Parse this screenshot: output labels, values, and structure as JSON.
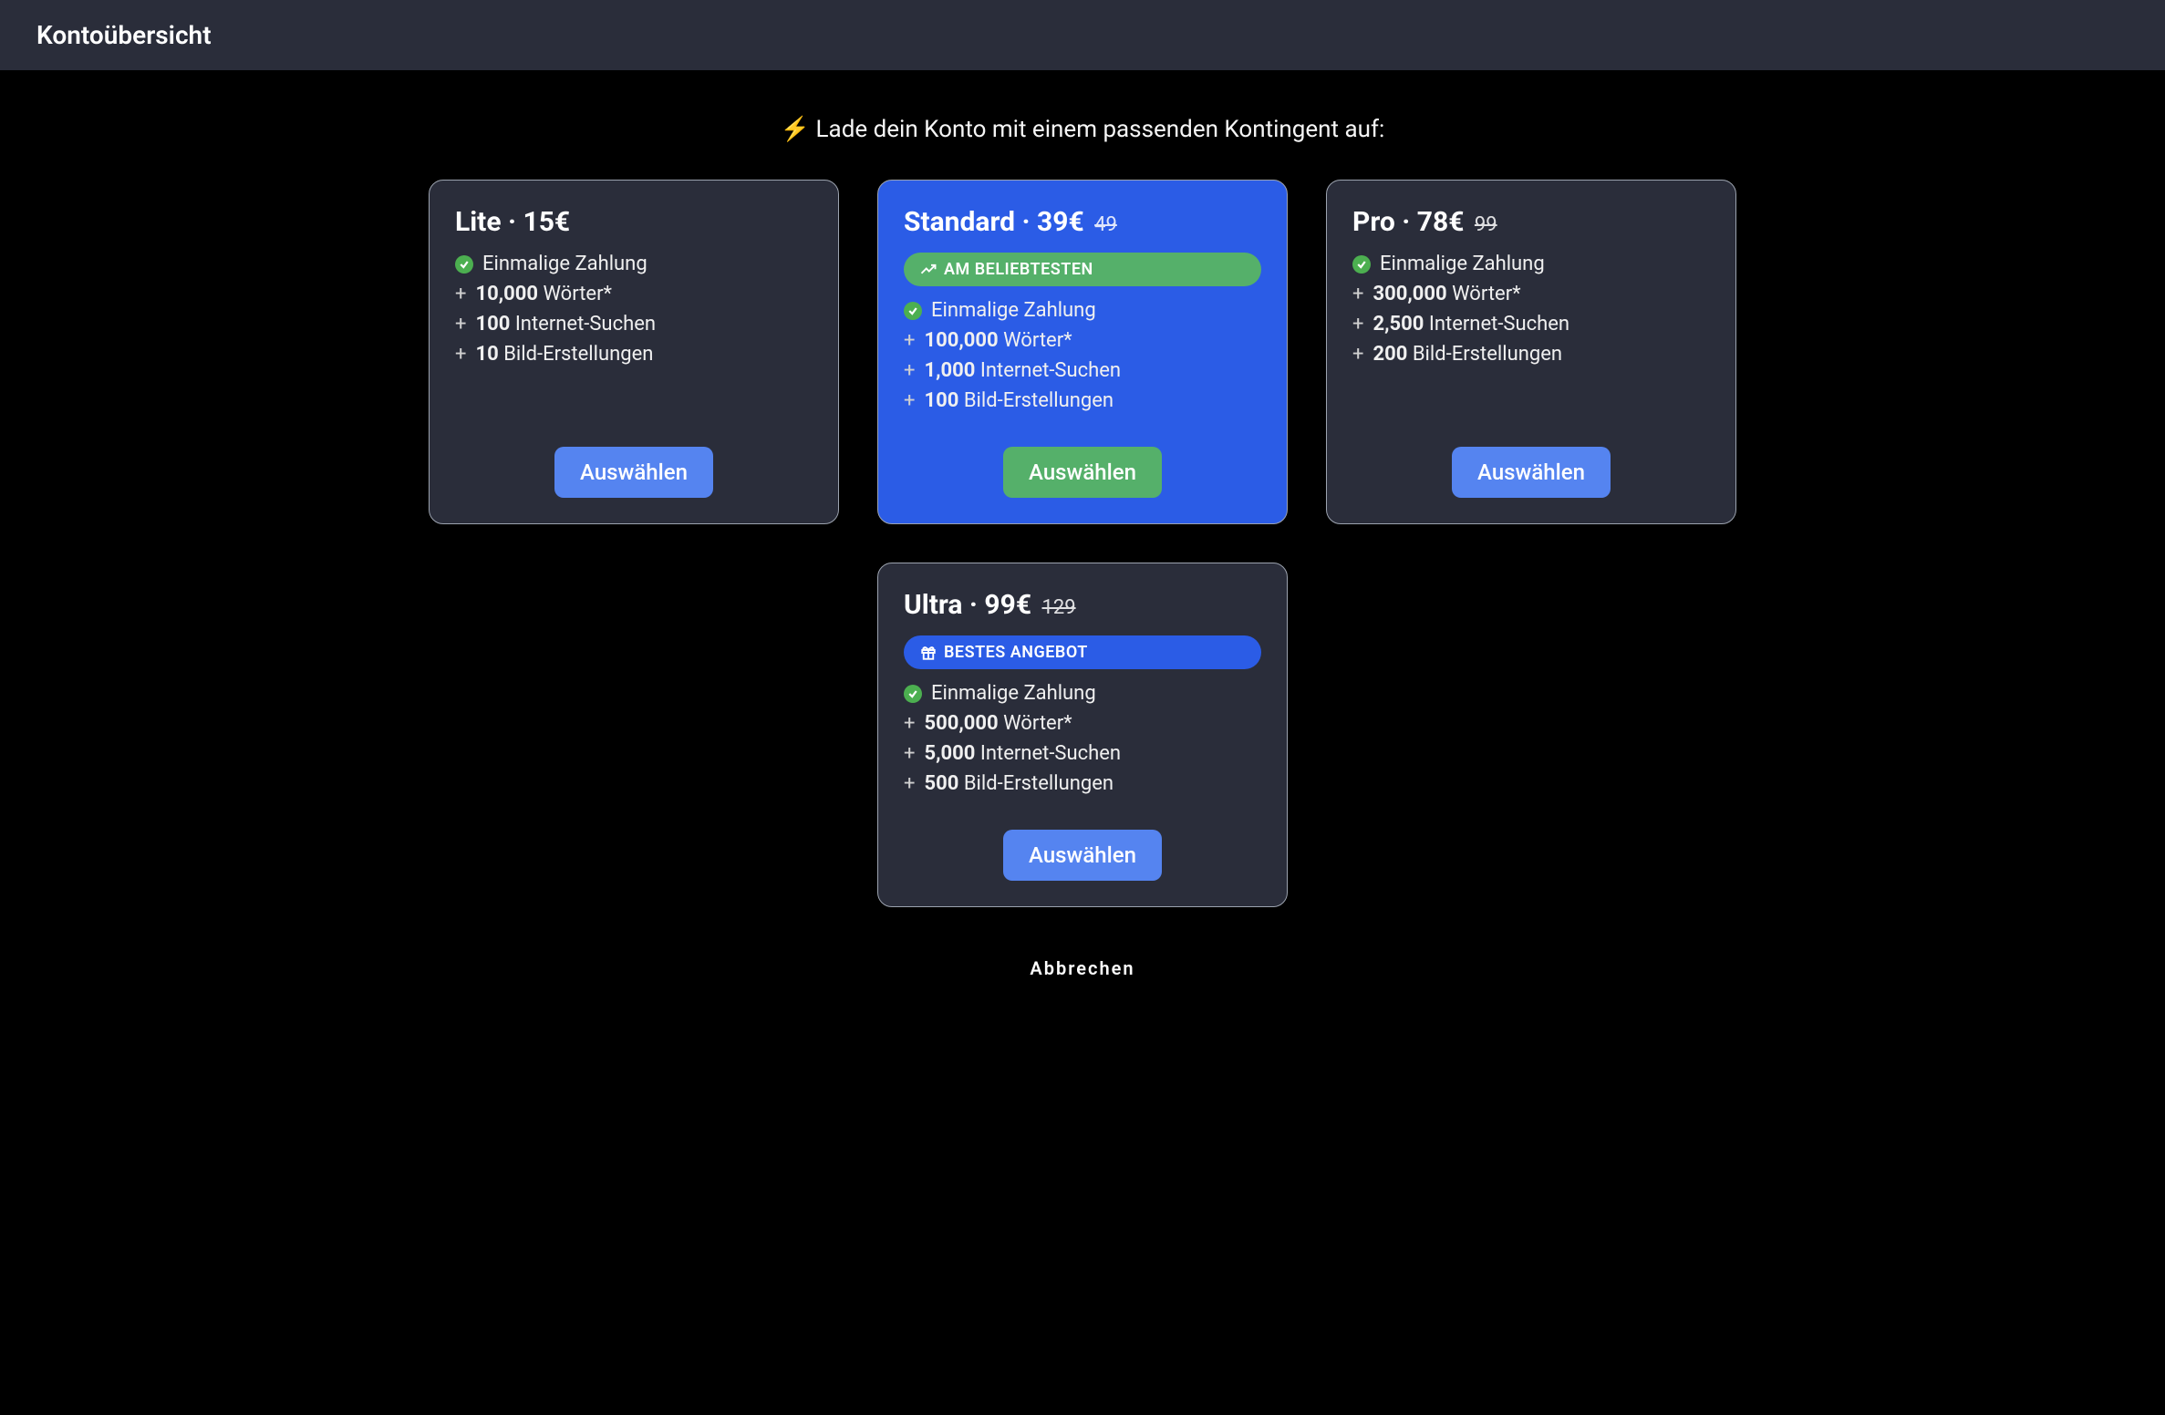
{
  "header": {
    "title": "Kontoübersicht"
  },
  "subtitle_emoji": "⚡",
  "subtitle": "Lade dein Konto mit einem passenden Kontingent auf:",
  "labels": {
    "select": "Auswählen",
    "cancel": "Abbrechen",
    "one_time_payment": "Einmalige Zahlung",
    "words_suffix": "Wörter*",
    "searches_suffix": "Internet-Suchen",
    "images_suffix": "Bild-Erstellungen",
    "most_popular": "AM BELIEBTESTEN",
    "best_offer": "BESTES ANGEBOT"
  },
  "plans": {
    "lite": {
      "name": "Lite",
      "price": "15€",
      "old_price": "",
      "words": "10,000",
      "searches": "100",
      "images": "10"
    },
    "standard": {
      "name": "Standard",
      "price": "39€",
      "old_price": "49",
      "words": "100,000",
      "searches": "1,000",
      "images": "100"
    },
    "pro": {
      "name": "Pro",
      "price": "78€",
      "old_price": "99",
      "words": "300,000",
      "searches": "2,500",
      "images": "200"
    },
    "ultra": {
      "name": "Ultra",
      "price": "99€",
      "old_price": "129",
      "words": "500,000",
      "searches": "5,000",
      "images": "500"
    }
  }
}
